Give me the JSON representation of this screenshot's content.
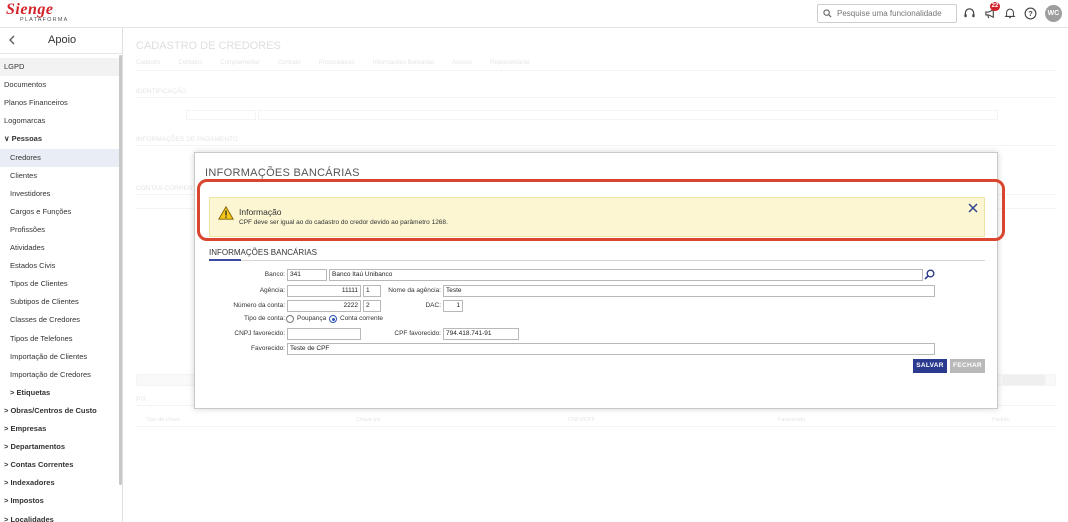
{
  "topbar": {
    "logo": "Sienge",
    "logo_sub": "PLATAFORMA",
    "search_placeholder": "Pesquise uma funcionalidade",
    "notification_count": "22",
    "avatar_initials": "WC"
  },
  "sidebar": {
    "title": "Apoio",
    "items": [
      {
        "label": "LGPD",
        "level": 0,
        "bold": false
      },
      {
        "label": "Documentos",
        "level": 0,
        "bold": false
      },
      {
        "label": "Planos Financeiros",
        "level": 0,
        "bold": false
      },
      {
        "label": "Logomarcas",
        "level": 0,
        "bold": false
      },
      {
        "label": "∨ Pessoas",
        "level": 0,
        "bold": true
      },
      {
        "label": "Credores",
        "level": 1,
        "bold": false,
        "active": true
      },
      {
        "label": "Clientes",
        "level": 1,
        "bold": false
      },
      {
        "label": "Investidores",
        "level": 1,
        "bold": false
      },
      {
        "label": "Cargos e Funções",
        "level": 1,
        "bold": false
      },
      {
        "label": "Profissões",
        "level": 1,
        "bold": false
      },
      {
        "label": "Atividades",
        "level": 1,
        "bold": false
      },
      {
        "label": "Estados Civis",
        "level": 1,
        "bold": false
      },
      {
        "label": "Tipos de Clientes",
        "level": 1,
        "bold": false
      },
      {
        "label": "Subtipos de Clientes",
        "level": 1,
        "bold": false
      },
      {
        "label": "Classes de Credores",
        "level": 1,
        "bold": false
      },
      {
        "label": "Tipos de Telefones",
        "level": 1,
        "bold": false
      },
      {
        "label": "Importação de Clientes",
        "level": 1,
        "bold": false
      },
      {
        "label": "Importação de Credores",
        "level": 1,
        "bold": false
      },
      {
        "label": "> Etiquetas",
        "level": 1,
        "bold": true
      },
      {
        "label": "> Obras/Centros de Custo",
        "level": 0,
        "bold": true
      },
      {
        "label": "> Empresas",
        "level": 0,
        "bold": true
      },
      {
        "label": "> Departamentos",
        "level": 0,
        "bold": true
      },
      {
        "label": "> Contas Correntes",
        "level": 0,
        "bold": true
      },
      {
        "label": "> Indexadores",
        "level": 0,
        "bold": true
      },
      {
        "label": "> Impostos",
        "level": 0,
        "bold": true
      },
      {
        "label": "> Localidades",
        "level": 0,
        "bold": true
      }
    ]
  },
  "background": {
    "title": "CADASTRO DE CREDORES",
    "tabs": [
      "Cadastro",
      "Contatos",
      "Complementar",
      "Contrato",
      "Procuradores",
      "Informações Bancárias",
      "Anexos",
      "Representante"
    ],
    "sec_identification": "IDENTIFICAÇÃO",
    "sec_payment": "INFORMAÇÕES DE PAGAMENTO",
    "sec_accounts": "CONTAS CORRENTES",
    "sec_pix": "PIX",
    "col_headers": [
      "Tipo de chave",
      "Chave pix",
      "CNPJ/CPF",
      "Favorecido",
      "Padrão"
    ]
  },
  "modal": {
    "title": "INFORMAÇÕES BANCÁRIAS",
    "alert": {
      "title": "Informação",
      "message": "CPF deve ser igual ao do cadastro do credor devido ao parâmetro 1268.",
      "close_icon": "close-icon"
    },
    "section_title": "INFORMAÇÕES BANCÁRIAS",
    "form": {
      "banco_label": "Banco:",
      "banco_code": "341",
      "banco_name": "Banco Itaú Unibanco",
      "agencia_label": "Agência:",
      "agencia_value": "11111",
      "agencia_digit": "1",
      "nome_agencia_label": "Nome da agência:",
      "nome_agencia_value": "Teste",
      "conta_label": "Número da conta:",
      "conta_value": "2222",
      "conta_digit": "2",
      "dac_label": "DAC:",
      "dac_value": "1",
      "tipo_conta_label": "Tipo de conta:",
      "tipo_conta_options": [
        "Poupança",
        "Conta corrente"
      ],
      "tipo_conta_selected": "Conta corrente",
      "cnpj_label": "CNPJ favorecido:",
      "cnpj_value": "",
      "cpf_label": "CPF favorecido:",
      "cpf_value": "794.418.741-91",
      "favorecido_label": "Favorecido:",
      "favorecido_value": "Teste de CPF"
    },
    "save_label": "SALVAR",
    "close_label": "FECHAR"
  },
  "colors": {
    "brand": "#d2232a",
    "primary": "#2a3a8f",
    "alert_bg": "#fcf6d2",
    "highlight": "#d9452f"
  }
}
